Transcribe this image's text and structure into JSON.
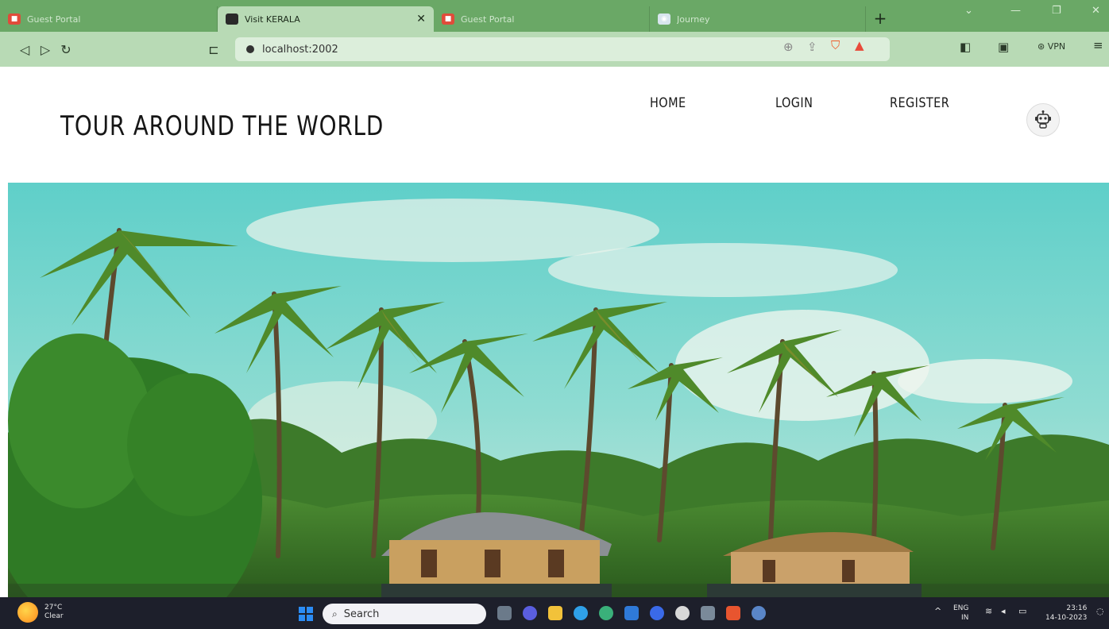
{
  "browser": {
    "tabs": [
      {
        "label": "Guest Portal",
        "icon": "portal-favicon-icon",
        "active": false
      },
      {
        "label": "Visit KERALA",
        "icon": "globe-favicon-icon",
        "active": true
      },
      {
        "label": "Guest Portal",
        "icon": "portal-favicon-icon",
        "active": false
      },
      {
        "label": "Journey",
        "icon": "journey-favicon-icon",
        "active": false
      }
    ],
    "url": "localhost:2002",
    "vpn_label": "VPN",
    "accent": "#6aa866"
  },
  "site": {
    "title": "TOUR AROUND THE WORLD",
    "nav": {
      "home": "HOME",
      "login": "LOGIN",
      "register": "REGISTER"
    },
    "chatbot_icon": "robot-icon"
  },
  "hero": {
    "image": "kerala-houseboat-palm-trees",
    "sky_color": "#6fd1cf",
    "foliage_color": "#3f7d2c"
  },
  "taskbar": {
    "weather": {
      "temp": "27°C",
      "condition": "Clear"
    },
    "search_placeholder": "Search",
    "lang": {
      "line1": "ENG",
      "line2": "IN"
    },
    "clock": {
      "time": "23:16",
      "date": "14-10-2023"
    }
  }
}
